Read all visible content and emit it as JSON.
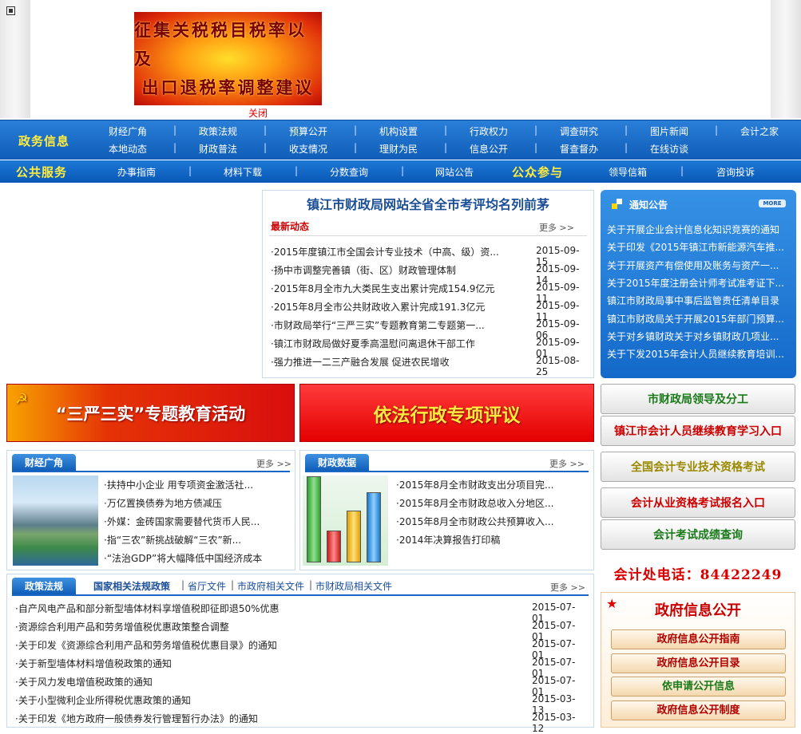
{
  "top_banner": {
    "line1": "征集关税税目税率以及",
    "line2": "出口退税率调整建议",
    "close_label": "关闭"
  },
  "nav": {
    "section_title": "政务信息",
    "row1": [
      "财经广角",
      "政策法规",
      "预算公开",
      "机构设置",
      "行政权力",
      "调查研究",
      "图片新闻",
      "会计之家"
    ],
    "row2": [
      "本地动态",
      "财政普法",
      "收支情况",
      "理财为民",
      "信息公开",
      "督查督办",
      "在线访谈"
    ]
  },
  "nav2": {
    "public_title": "公共服务",
    "public_items": [
      "办事指南",
      "材料下载",
      "分数查询",
      "网站公告"
    ],
    "participate_title": "公众参与",
    "participate_items": [
      "领导信箱",
      "咨询投诉"
    ]
  },
  "news": {
    "headline": "镇江市财政局网站全省全市考评均名列前茅",
    "subtitle": "最新动态",
    "more_label": "更多 >>",
    "items": [
      {
        "title": "·2015年度镇江市全国会计专业技术（中高、级）资...",
        "date": "2015-09-15"
      },
      {
        "title": "·扬中市调整完善镇（街、区）财政管理体制",
        "date": "2015-09-14"
      },
      {
        "title": "·2015年8月全市九大类民生支出累计完成154.9亿元",
        "date": "2015-09-11"
      },
      {
        "title": "·2015年8月全市公共财政收入累计完成191.3亿元",
        "date": "2015-09-11"
      },
      {
        "title": "·市财政局举行“三严三实”专题教育第二专题第一...",
        "date": "2015-09-06"
      },
      {
        "title": "·镇江市财政局做好夏季高温慰问离退休干部工作",
        "date": "2015-09-01"
      },
      {
        "title": "·强力推进一二三产融合发展 促进农民增收",
        "date": "2015-08-25"
      }
    ]
  },
  "notice": {
    "title": "通知公告",
    "more_label": "MORE",
    "items": [
      "关于开展企业会计信息化知识竞赛的通知",
      "关于印发《2015年镇江市新能源汽车推...",
      "关于开展资产有偿使用及账务与资产一...",
      "关于2015年度注册会计师考试准考证下...",
      "镇江市财政局事中事后监管责任清单目录",
      "镇江市财政局关于开展2015年部门预算...",
      "关于对乡镇财政关于对乡镇财政几项业...",
      "关于下发2015年会计人员继续教育培训..."
    ]
  },
  "big_banners": {
    "sanyan": "“三严三实”专题教育活动",
    "yifa": "依法行政专项评议"
  },
  "right_buttons": [
    {
      "label": "市财政局领导及分工",
      "color": "#1a7a1a"
    },
    {
      "label": "镇江市会计人员继续教育学习入口",
      "color": "#cc0000"
    },
    {
      "label": "全国会计专业技术资格考试",
      "color": "#9a8a00"
    },
    {
      "label": "会计从业资格考试报名入口",
      "color": "#cc0000"
    },
    {
      "label": "会计考试成绩查询",
      "color": "#1a7a1a"
    }
  ],
  "phone": "会计处电话：84422249",
  "gov_info": {
    "title": "政府信息公开",
    "buttons": [
      {
        "label": "政府信息公开指南",
        "color": "#b00000"
      },
      {
        "label": "政府信息公开目录",
        "color": "#b00000"
      },
      {
        "label": "依申请公开信息",
        "color": "#1a7a1a"
      },
      {
        "label": "政府信息公开制度",
        "color": "#b00000"
      }
    ]
  },
  "finance_angle": {
    "tab": "财经广角",
    "more_label": "更多 >>",
    "items": [
      "·扶持中小企业 用专项资金激活社...",
      "·万亿置换债券为地方债减压",
      "·外媒：金砖国家需要替代货币人民...",
      "·指“三农”新挑战破解“三农”新...",
      "·“法治GDP”将大幅降低中国经济成本"
    ]
  },
  "finance_data": {
    "tab": "财政数据",
    "more_label": "更多 >>",
    "items": [
      "·2015年8月全市财政支出分项目完...",
      "·2015年8月全市财政总收入分地区...",
      "·2015年8月全市财政公共预算收入...",
      "·2014年决算报告打印稿"
    ]
  },
  "policy": {
    "tab": "政策法规",
    "links": [
      "国家相关法规政策",
      "省厅文件",
      "市政府相关文件",
      "市财政局相关文件"
    ],
    "more_label": "更多 >>",
    "items": [
      {
        "title": "·自产风电产品和部分新型墙体材料享增值税即征即退50%优惠",
        "date": "2015-07-01"
      },
      {
        "title": "·资源综合利用产品和劳务增值税优惠政策整合调整",
        "date": "2015-07-01"
      },
      {
        "title": "·关于印发《资源综合利用产品和劳务增值税优惠目录》的通知",
        "date": "2015-07-01"
      },
      {
        "title": "·关于新型墙体材料增值税政策的通知",
        "date": "2015-07-01"
      },
      {
        "title": "·关于风力发电增值税政策的通知",
        "date": "2015-07-01"
      },
      {
        "title": "·关于小型微利企业所得税优惠政策的通知",
        "date": "2015-03-13"
      },
      {
        "title": "·关于印发《地方政府一般债券发行管理暂行办法》的通知",
        "date": "2015-03-12"
      }
    ]
  }
}
